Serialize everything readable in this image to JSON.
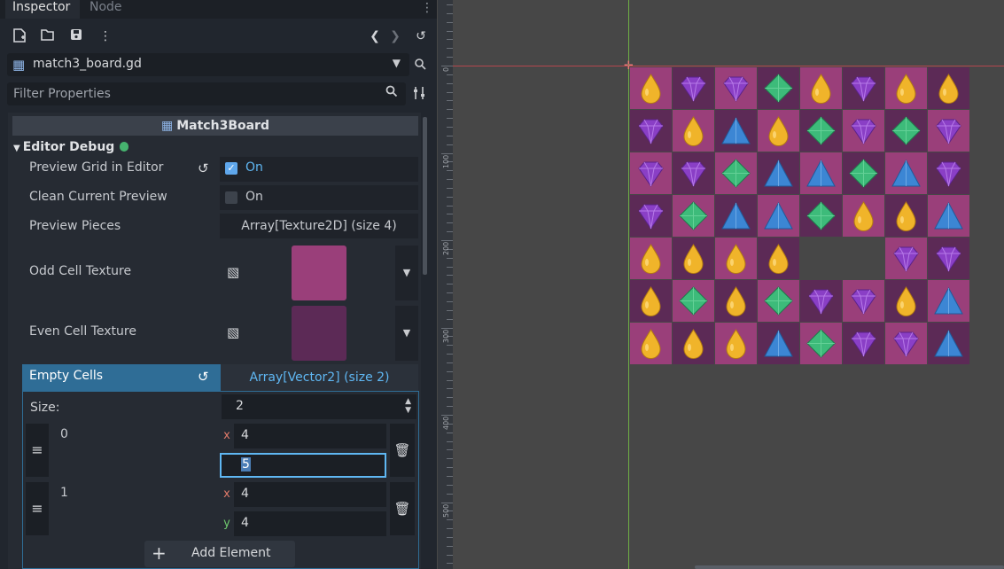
{
  "tabs": {
    "inspector": "Inspector",
    "node": "Node"
  },
  "toolbar": {
    "new_icon": "new-resource-icon",
    "open_icon": "folder-open-icon",
    "save_icon": "save-icon",
    "menu_icon": "kebab-menu-icon",
    "back_icon": "chevron-left-icon",
    "forward_icon": "chevron-right-icon",
    "history_icon": "history-icon"
  },
  "script": {
    "name": "match3_board.gd"
  },
  "filter": {
    "placeholder": "Filter Properties",
    "value": ""
  },
  "class_header": {
    "name": "Match3Board"
  },
  "section": {
    "title": "Editor Debug"
  },
  "props": {
    "preview_grid": {
      "label": "Preview Grid in Editor",
      "value": "On",
      "checked": true
    },
    "clean_preview": {
      "label": "Clean Current Preview",
      "value": "On",
      "checked": false
    },
    "preview_pieces": {
      "label": "Preview Pieces",
      "value": "Array[Texture2D] (size 4)"
    },
    "odd_cell": {
      "label": "Odd Cell Texture",
      "color": "#9a3f7a"
    },
    "even_cell": {
      "label": "Even Cell Texture",
      "color": "#5c2a56"
    },
    "empty_cells": {
      "label": "Empty Cells",
      "value": "Array[Vector2] (size 2)"
    }
  },
  "array": {
    "size_label": "Size:",
    "size": "2",
    "items": [
      {
        "index": "0",
        "x": "4",
        "y": "5"
      },
      {
        "index": "1",
        "x": "4",
        "y": "4"
      }
    ],
    "add_label": "Add Element",
    "axis_x": "x",
    "axis_y": "y"
  },
  "ruler": {
    "labels": [
      "0",
      "100",
      "200",
      "300",
      "400",
      "500"
    ]
  },
  "board": {
    "odd_color": "#9a3f7a",
    "even_color": "#5c2a56",
    "cols": 8,
    "rows": 7,
    "pieces": [
      [
        "yellow",
        "purple",
        "purple",
        "green",
        "yellow",
        "purple",
        "yellow",
        "yellow"
      ],
      [
        "purple",
        "yellow",
        "blue",
        "yellow",
        "green",
        "purple",
        "green",
        "purple"
      ],
      [
        "purple",
        "purple",
        "green",
        "blue",
        "blue",
        "green",
        "blue",
        "purple"
      ],
      [
        "purple",
        "green",
        "blue",
        "blue",
        "green",
        "yellow",
        "yellow",
        "blue"
      ],
      [
        "yellow",
        "yellow",
        "yellow",
        "yellow",
        "empty",
        "empty",
        "purple",
        "purple"
      ],
      [
        "yellow",
        "green",
        "yellow",
        "green",
        "purple",
        "purple",
        "yellow",
        "blue"
      ],
      [
        "yellow",
        "yellow",
        "yellow",
        "blue",
        "green",
        "purple",
        "purple",
        "blue"
      ]
    ],
    "piece_colors": {
      "yellow": "#f0b42a",
      "purple": "#8a3fc6",
      "green": "#3dbb7a",
      "blue": "#3c86d4"
    }
  }
}
